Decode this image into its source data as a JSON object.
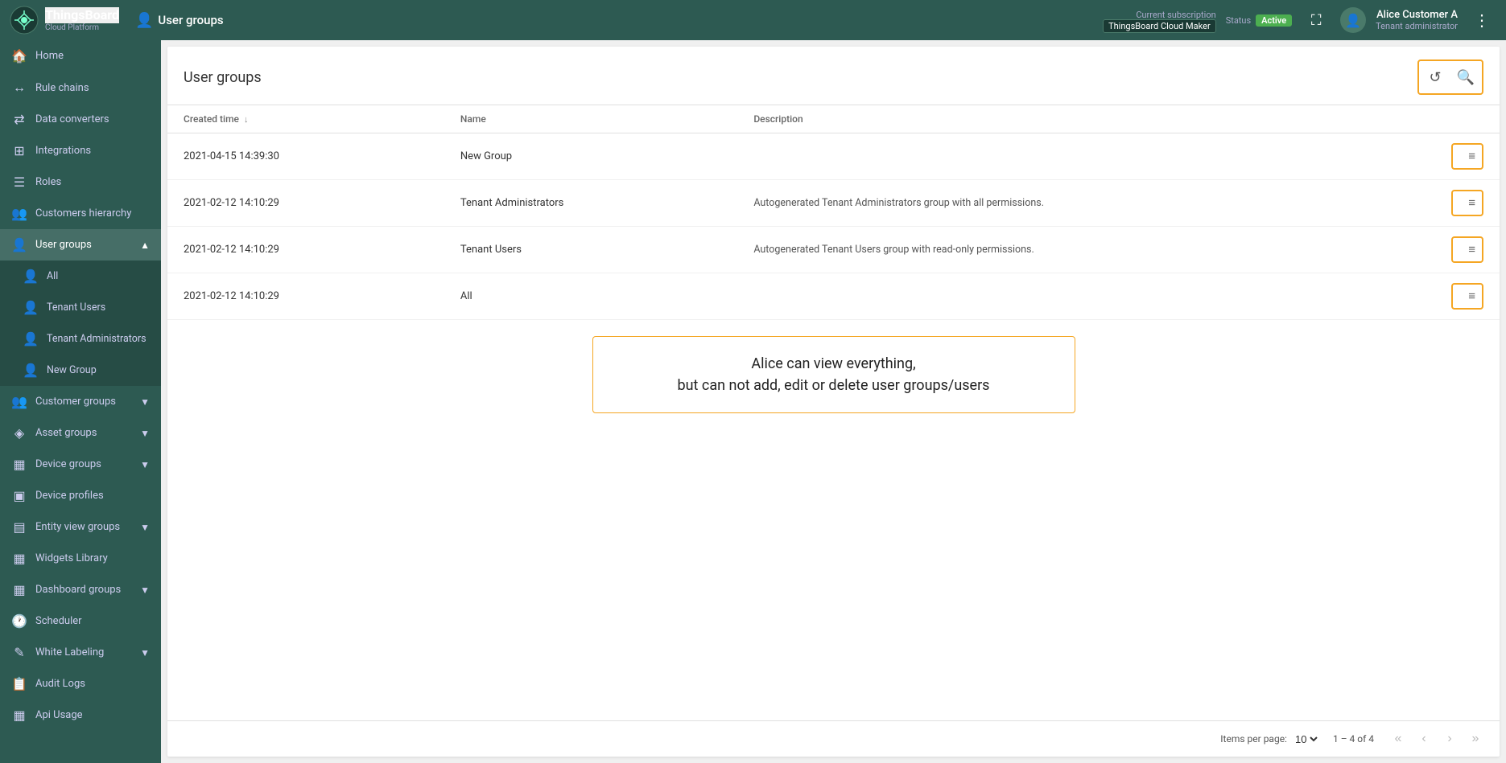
{
  "topbar": {
    "logo_main": "ThingsBoard",
    "logo_sub": "Cloud Platform",
    "page_icon": "👤",
    "page_title": "User groups",
    "subscription_label": "Current subscription",
    "subscription_value": "ThingsBoard Cloud Maker",
    "status_label": "Status",
    "status_value": "Active",
    "expand_icon": "⛶",
    "user_name": "Alice Customer A",
    "user_role": "Tenant administrator",
    "more_icon": "⋮"
  },
  "sidebar": {
    "items": [
      {
        "id": "home",
        "label": "Home",
        "icon": "🏠",
        "expandable": false
      },
      {
        "id": "rule-chains",
        "label": "Rule chains",
        "icon": "↔",
        "expandable": false
      },
      {
        "id": "data-converters",
        "label": "Data converters",
        "icon": "⇄",
        "expandable": false
      },
      {
        "id": "integrations",
        "label": "Integrations",
        "icon": "⊞",
        "expandable": false
      },
      {
        "id": "roles",
        "label": "Roles",
        "icon": "☰",
        "expandable": false
      },
      {
        "id": "customers-hierarchy",
        "label": "Customers hierarchy",
        "icon": "👥",
        "expandable": false
      },
      {
        "id": "user-groups",
        "label": "User groups",
        "icon": "👤",
        "expandable": true,
        "active": true
      },
      {
        "id": "customer-groups",
        "label": "Customer groups",
        "icon": "👥",
        "expandable": true
      },
      {
        "id": "asset-groups",
        "label": "Asset groups",
        "icon": "◈",
        "expandable": true
      },
      {
        "id": "device-groups",
        "label": "Device groups",
        "icon": "▦",
        "expandable": true
      },
      {
        "id": "device-profiles",
        "label": "Device profiles",
        "icon": "▣",
        "expandable": false
      },
      {
        "id": "entity-view-groups",
        "label": "Entity view groups",
        "icon": "▤",
        "expandable": true
      },
      {
        "id": "widgets-library",
        "label": "Widgets Library",
        "icon": "▦",
        "expandable": false
      },
      {
        "id": "dashboard-groups",
        "label": "Dashboard groups",
        "icon": "▦",
        "expandable": true
      },
      {
        "id": "scheduler",
        "label": "Scheduler",
        "icon": "🕐",
        "expandable": false
      },
      {
        "id": "white-labeling",
        "label": "White Labeling",
        "icon": "✎",
        "expandable": true
      },
      {
        "id": "audit-logs",
        "label": "Audit Logs",
        "icon": "📋",
        "expandable": false
      },
      {
        "id": "api-usage",
        "label": "Api Usage",
        "icon": "▦",
        "expandable": false
      }
    ],
    "user_group_subitems": [
      {
        "id": "all",
        "label": "All",
        "icon": "👤",
        "active": false
      },
      {
        "id": "tenant-users",
        "label": "Tenant Users",
        "icon": "👤",
        "active": false
      },
      {
        "id": "tenant-administrators",
        "label": "Tenant Administrators",
        "icon": "👤",
        "active": false
      },
      {
        "id": "new-group",
        "label": "New Group",
        "icon": "👤",
        "active": false
      }
    ]
  },
  "content": {
    "title": "User groups",
    "refresh_icon": "↺",
    "search_icon": "🔍",
    "table": {
      "columns": [
        {
          "id": "created_time",
          "label": "Created time",
          "sortable": true
        },
        {
          "id": "name",
          "label": "Name",
          "sortable": false
        },
        {
          "id": "description",
          "label": "Description",
          "sortable": false
        }
      ],
      "rows": [
        {
          "created_time": "2021-04-15 14:39:30",
          "name": "New Group",
          "description": "",
          "action_icon": "≡"
        },
        {
          "created_time": "2021-02-12 14:10:29",
          "name": "Tenant Administrators",
          "description": "Autogenerated Tenant Administrators group with all permissions.",
          "action_icon": "≡"
        },
        {
          "created_time": "2021-02-12 14:10:29",
          "name": "Tenant Users",
          "description": "Autogenerated Tenant Users group with read-only permissions.",
          "action_icon": "≡"
        },
        {
          "created_time": "2021-02-12 14:10:29",
          "name": "All",
          "description": "",
          "action_icon": "≡"
        }
      ]
    },
    "info_message": "Alice can view everything,\nbut can not add, edit or delete user groups/users",
    "pagination": {
      "items_per_page_label": "Items per page:",
      "items_per_page_value": "10",
      "range_text": "1 – 4 of 4",
      "first_icon": "«",
      "prev_icon": "‹",
      "next_icon": "›",
      "last_icon": "»"
    }
  }
}
